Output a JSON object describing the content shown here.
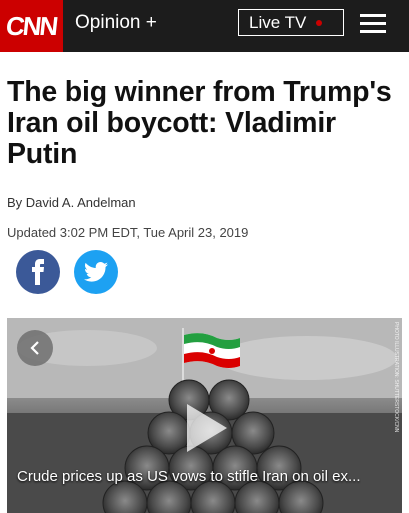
{
  "header": {
    "logo": "CNN",
    "section": "Opinion +",
    "live_label": "Live TV",
    "menu_icon": "hamburger-menu-icon"
  },
  "article": {
    "headline": "The big winner from Trump's Iran oil boycott: Vladimir Putin",
    "byline": "By David A. Andelman",
    "updated": "Updated 3:02 PM EDT, Tue April 23, 2019"
  },
  "social": {
    "facebook_icon": "facebook-icon",
    "twitter_icon": "twitter-icon"
  },
  "media": {
    "caption": "Crude prices up as US vows to stifle Iran on oil ex...",
    "credit": "PHOTO ILLUSTRATION: SHUTTERSTOCK/CNN"
  },
  "colors": {
    "brand": "#cc0000",
    "topbar": "#1c1c1c",
    "facebook": "#3b5998",
    "twitter": "#1da1f2"
  }
}
